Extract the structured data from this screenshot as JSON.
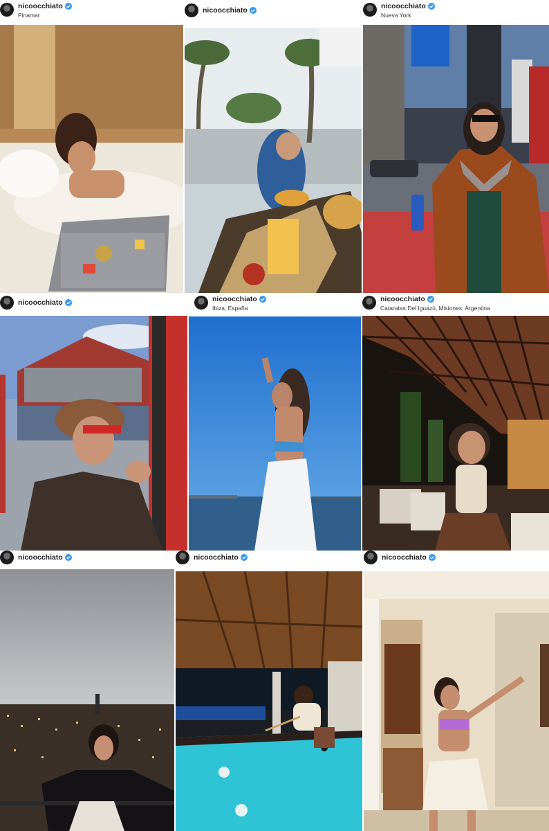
{
  "posts": [
    {
      "username": "nicoocchiato",
      "location": "Pinamar",
      "verified_icon": "verified-badge-icon"
    },
    {
      "username": "",
      "location": "",
      "verified_icon": "verified-badge-icon"
    },
    {
      "username": "nicoocchiato",
      "location": "Nueva York",
      "verified_icon": "verified-badge-icon"
    },
    {
      "username": "nicoocchiato",
      "location": "",
      "verified_icon": "verified-badge-icon"
    },
    {
      "username": "nicoocchiato",
      "location": "Ibiza, España",
      "verified_icon": "verified-badge-icon"
    },
    {
      "username": "nicoocchiato",
      "location": "Cataratas Del Iguazú, Misiones, Argentina",
      "verified_icon": "verified-badge-icon"
    },
    {
      "username": "nicoocchiato",
      "location": "",
      "verified_icon": "verified-badge-icon"
    },
    {
      "username": "nicoocchiato",
      "location": "",
      "verified_icon": "verified-badge-icon"
    },
    {
      "username": "nicoocchiato",
      "location": "",
      "verified_icon": "verified-badge-icon"
    }
  ],
  "colors": {
    "verified": "#3897f0",
    "username": "#222222"
  }
}
